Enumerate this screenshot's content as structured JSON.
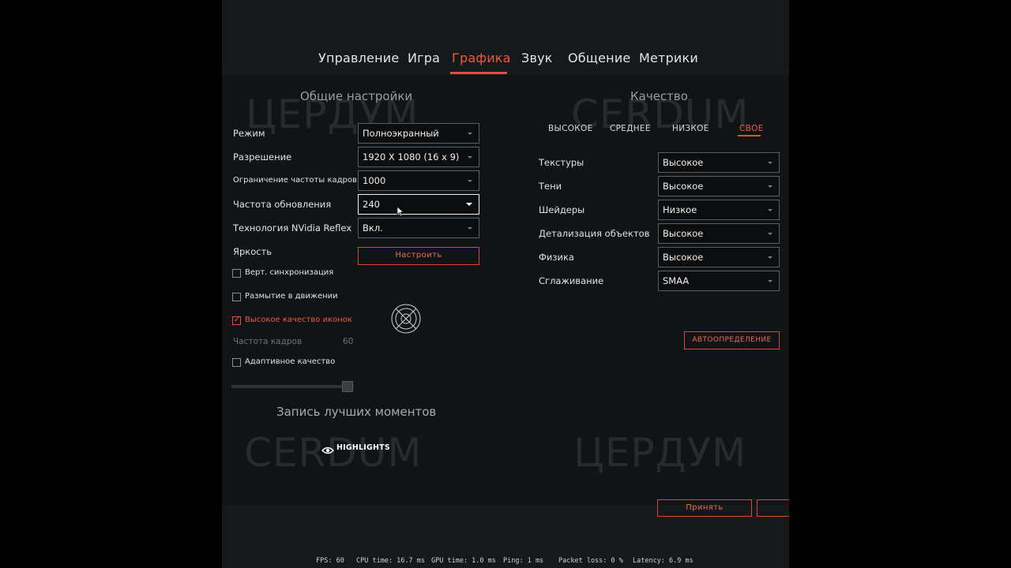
{
  "tabs": [
    "Управление",
    "Игра",
    "Графика",
    "Звук",
    "Общение",
    "Метрики"
  ],
  "watermark": {
    "tl": "ЦЕРДУМ",
    "tr": "CERDUM",
    "bl": "CERDUM",
    "br": "ЦЕРДУМ"
  },
  "general": {
    "title": "Общие настройки",
    "mode": {
      "label": "Режим",
      "value": "Полноэкранный"
    },
    "resolution": {
      "label": "Разрешение",
      "value": "1920 X 1080 (16 x 9)"
    },
    "fps_limit": {
      "label": "Ограничение частоты кадров",
      "value": "1000"
    },
    "refresh_rate": {
      "label": "Частота обновления",
      "value": "240"
    },
    "reflex": {
      "label": "Технология NVidia Reflex",
      "value": "Вкл."
    },
    "brightness": {
      "label": "Яркость",
      "button": "Настроить"
    },
    "vsync": {
      "label": "Верт. синхронизация",
      "checked": false
    },
    "motion_blur": {
      "label": "Размытие в движении",
      "checked": false
    },
    "hq_icons": {
      "label": "Высокое качество иконок",
      "checked": true
    },
    "frame_rate": {
      "label": "Частота кадров",
      "value": "60"
    },
    "adaptive": {
      "label": "Адаптивное качество",
      "checked": false
    },
    "adaptive_slider": 1.0
  },
  "highlights": {
    "title": "Запись лучших моментов",
    "label": "HIGHLIGHTS"
  },
  "quality": {
    "title": "Качество",
    "presets": [
      "ВЫСОКОЕ",
      "СРЕДНЕЕ",
      "НИЗКОЕ",
      "СВОЕ"
    ],
    "textures": {
      "label": "Текстуры",
      "value": "Высокое"
    },
    "shadows": {
      "label": "Тени",
      "value": "Высокое"
    },
    "shaders": {
      "label": "Шейдеры",
      "value": "Низкое"
    },
    "detail": {
      "label": "Детализация объектов",
      "value": "Высокое"
    },
    "physics": {
      "label": "Физика",
      "value": "Высокое"
    },
    "antialiasing": {
      "label": "Сглаживание",
      "value": "SMAA"
    },
    "autodetect": "АВТООПРЕДЕЛЕНИЕ"
  },
  "footer": {
    "accept": "Принять"
  },
  "status": {
    "fps": "FPS: 60",
    "cpu": "CPU time: 16.7 ms",
    "gpu": "GPU time: 1.0 ms",
    "ping": "Ping: 1 ms",
    "packet": "Packet loss: 0 %",
    "latency": "Latency: 6.9 ms"
  },
  "colors": {
    "accent": "#e2503a",
    "background": "#15191c"
  }
}
